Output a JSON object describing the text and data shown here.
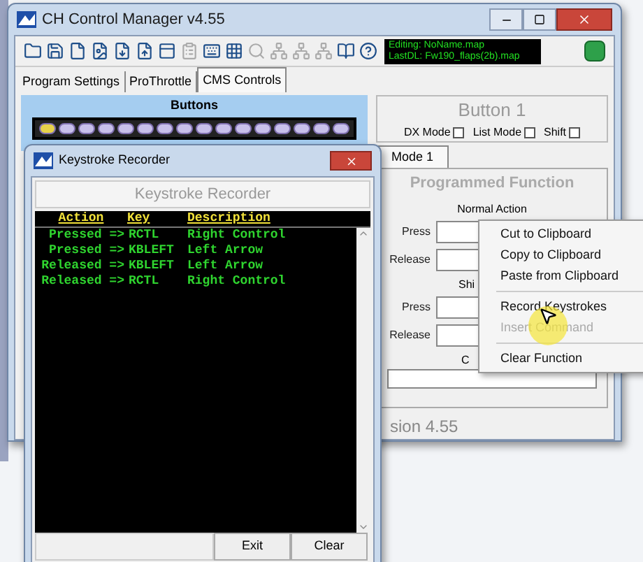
{
  "main_window": {
    "title": "CH Control Manager v4.55",
    "status_lines": [
      "Editing: NoName.map",
      "LastDL: Fw190_flaps(2b).map"
    ],
    "tabs": [
      {
        "label": "Program Settings",
        "selected": false
      },
      {
        "label": "ProThrottle",
        "selected": false
      },
      {
        "label": "CMS Controls",
        "selected": true
      }
    ],
    "buttons_panel": {
      "title": "Buttons",
      "buttons": [
        {
          "selected": true
        },
        {
          "selected": false
        },
        {
          "selected": false
        },
        {
          "selected": false
        },
        {
          "selected": false
        },
        {
          "selected": false
        },
        {
          "selected": false
        },
        {
          "selected": false
        },
        {
          "selected": false
        },
        {
          "selected": false
        },
        {
          "selected": false
        },
        {
          "selected": false
        },
        {
          "selected": false
        },
        {
          "selected": false
        },
        {
          "selected": false
        },
        {
          "selected": false
        }
      ]
    },
    "button_panel": {
      "title": "Button 1",
      "options": [
        {
          "label": "DX Mode",
          "checked": false
        },
        {
          "label": "List Mode",
          "checked": false
        },
        {
          "label": "Shift",
          "checked": false
        }
      ]
    },
    "mode_tabs": [
      {
        "label": "Mode 1",
        "selected": true
      }
    ],
    "function_panel": {
      "title": "Programmed Function",
      "normal_label": "Normal Action",
      "normal_fields": [
        {
          "label": "Press"
        },
        {
          "label": "Release"
        }
      ],
      "shift_label": "Shi",
      "shift_fields": [
        {
          "label": "Press"
        },
        {
          "label": "Release"
        }
      ],
      "third_label": "C"
    },
    "version": "sion 4.55"
  },
  "recorder": {
    "title": "Keystroke Recorder",
    "heading": "Keystroke Recorder",
    "columns": [
      "Action",
      "Key",
      "Description"
    ],
    "rows": [
      [
        "Pressed =>",
        "RCTL",
        "Right Control"
      ],
      [
        "Pressed =>",
        "KBLEFT",
        "Left Arrow"
      ],
      [
        "Released =>",
        "KBLEFT",
        "Left Arrow"
      ],
      [
        "Released =>",
        "RCTL",
        "Right Control"
      ]
    ],
    "buttons": [
      "Exit",
      "Clear"
    ]
  },
  "context_menu": [
    {
      "kind": "item",
      "label": "Cut to Clipboard",
      "disabled": false
    },
    {
      "kind": "item",
      "label": "Copy to Clipboard",
      "disabled": false
    },
    {
      "kind": "item",
      "label": "Paste from Clipboard",
      "disabled": false
    },
    {
      "kind": "separator"
    },
    {
      "kind": "item",
      "label": "Record Keystrokes",
      "disabled": false
    },
    {
      "kind": "item",
      "label": "Insert Command",
      "disabled": true
    },
    {
      "kind": "separator"
    },
    {
      "kind": "item",
      "label": "Clear Function",
      "disabled": false
    }
  ]
}
